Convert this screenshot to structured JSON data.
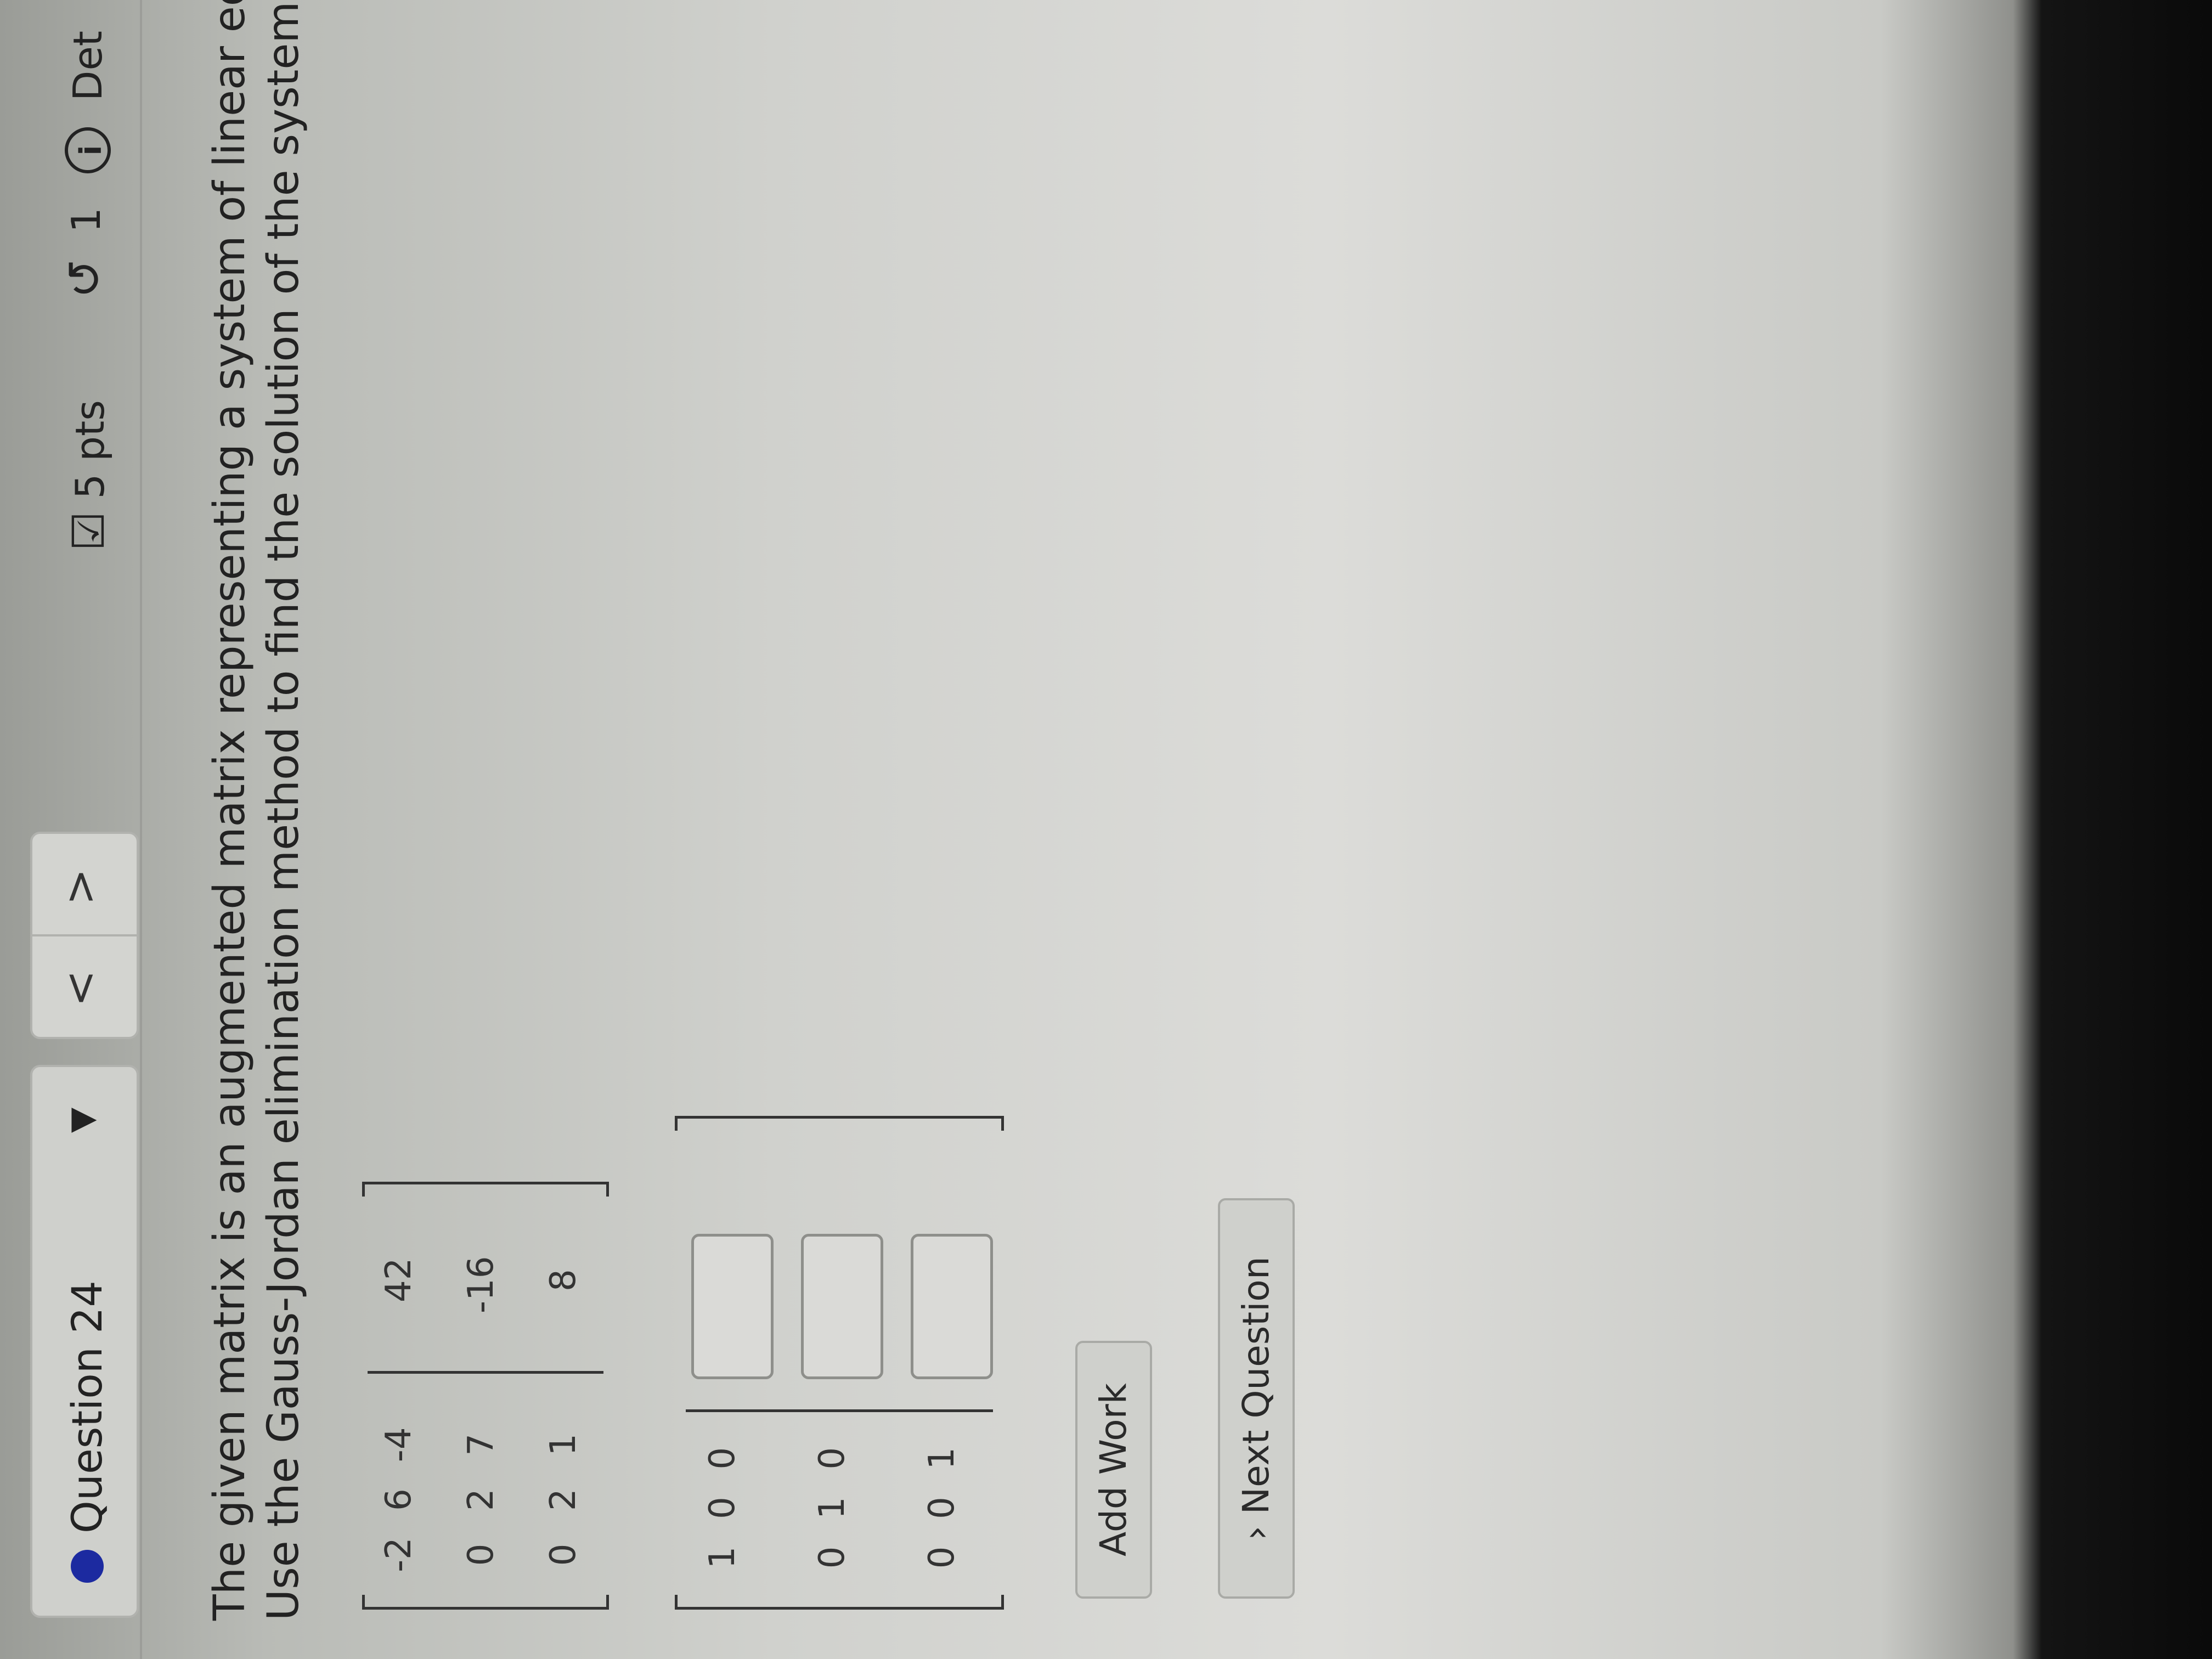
{
  "header": {
    "question_label": "Question 24",
    "dropdown_caret": "▼",
    "prev_symbol": "<",
    "next_symbol": ">",
    "points_icon": "☑",
    "points": "5 pts",
    "retry_icon": "↺",
    "retry_count": "1",
    "info_icon": "i",
    "details_label": "Det"
  },
  "question": {
    "line1": "The given matrix is an augmented matrix representing a system of linear equations.",
    "line2": "Use the Gauss-Jordan elimination method to find the solution of the system."
  },
  "given_matrix": {
    "rows": [
      {
        "coeffs": [
          "-2",
          "6",
          "-4"
        ],
        "rhs": "42"
      },
      {
        "coeffs": [
          "0",
          "2",
          "7"
        ],
        "rhs": "-16"
      },
      {
        "coeffs": [
          "0",
          "2",
          "1"
        ],
        "rhs": "8"
      }
    ]
  },
  "answer_matrix": {
    "rows": [
      {
        "coeffs": [
          "1",
          "0",
          "0"
        ],
        "rhs": ""
      },
      {
        "coeffs": [
          "0",
          "1",
          "0"
        ],
        "rhs": ""
      },
      {
        "coeffs": [
          "0",
          "0",
          "1"
        ],
        "rhs": ""
      }
    ]
  },
  "buttons": {
    "add_work": "Add Work",
    "next_question": "› Next Question"
  },
  "colors": {
    "question_dot": "#1c2aa0",
    "text": "#222222",
    "border": "#b1b2ae"
  }
}
